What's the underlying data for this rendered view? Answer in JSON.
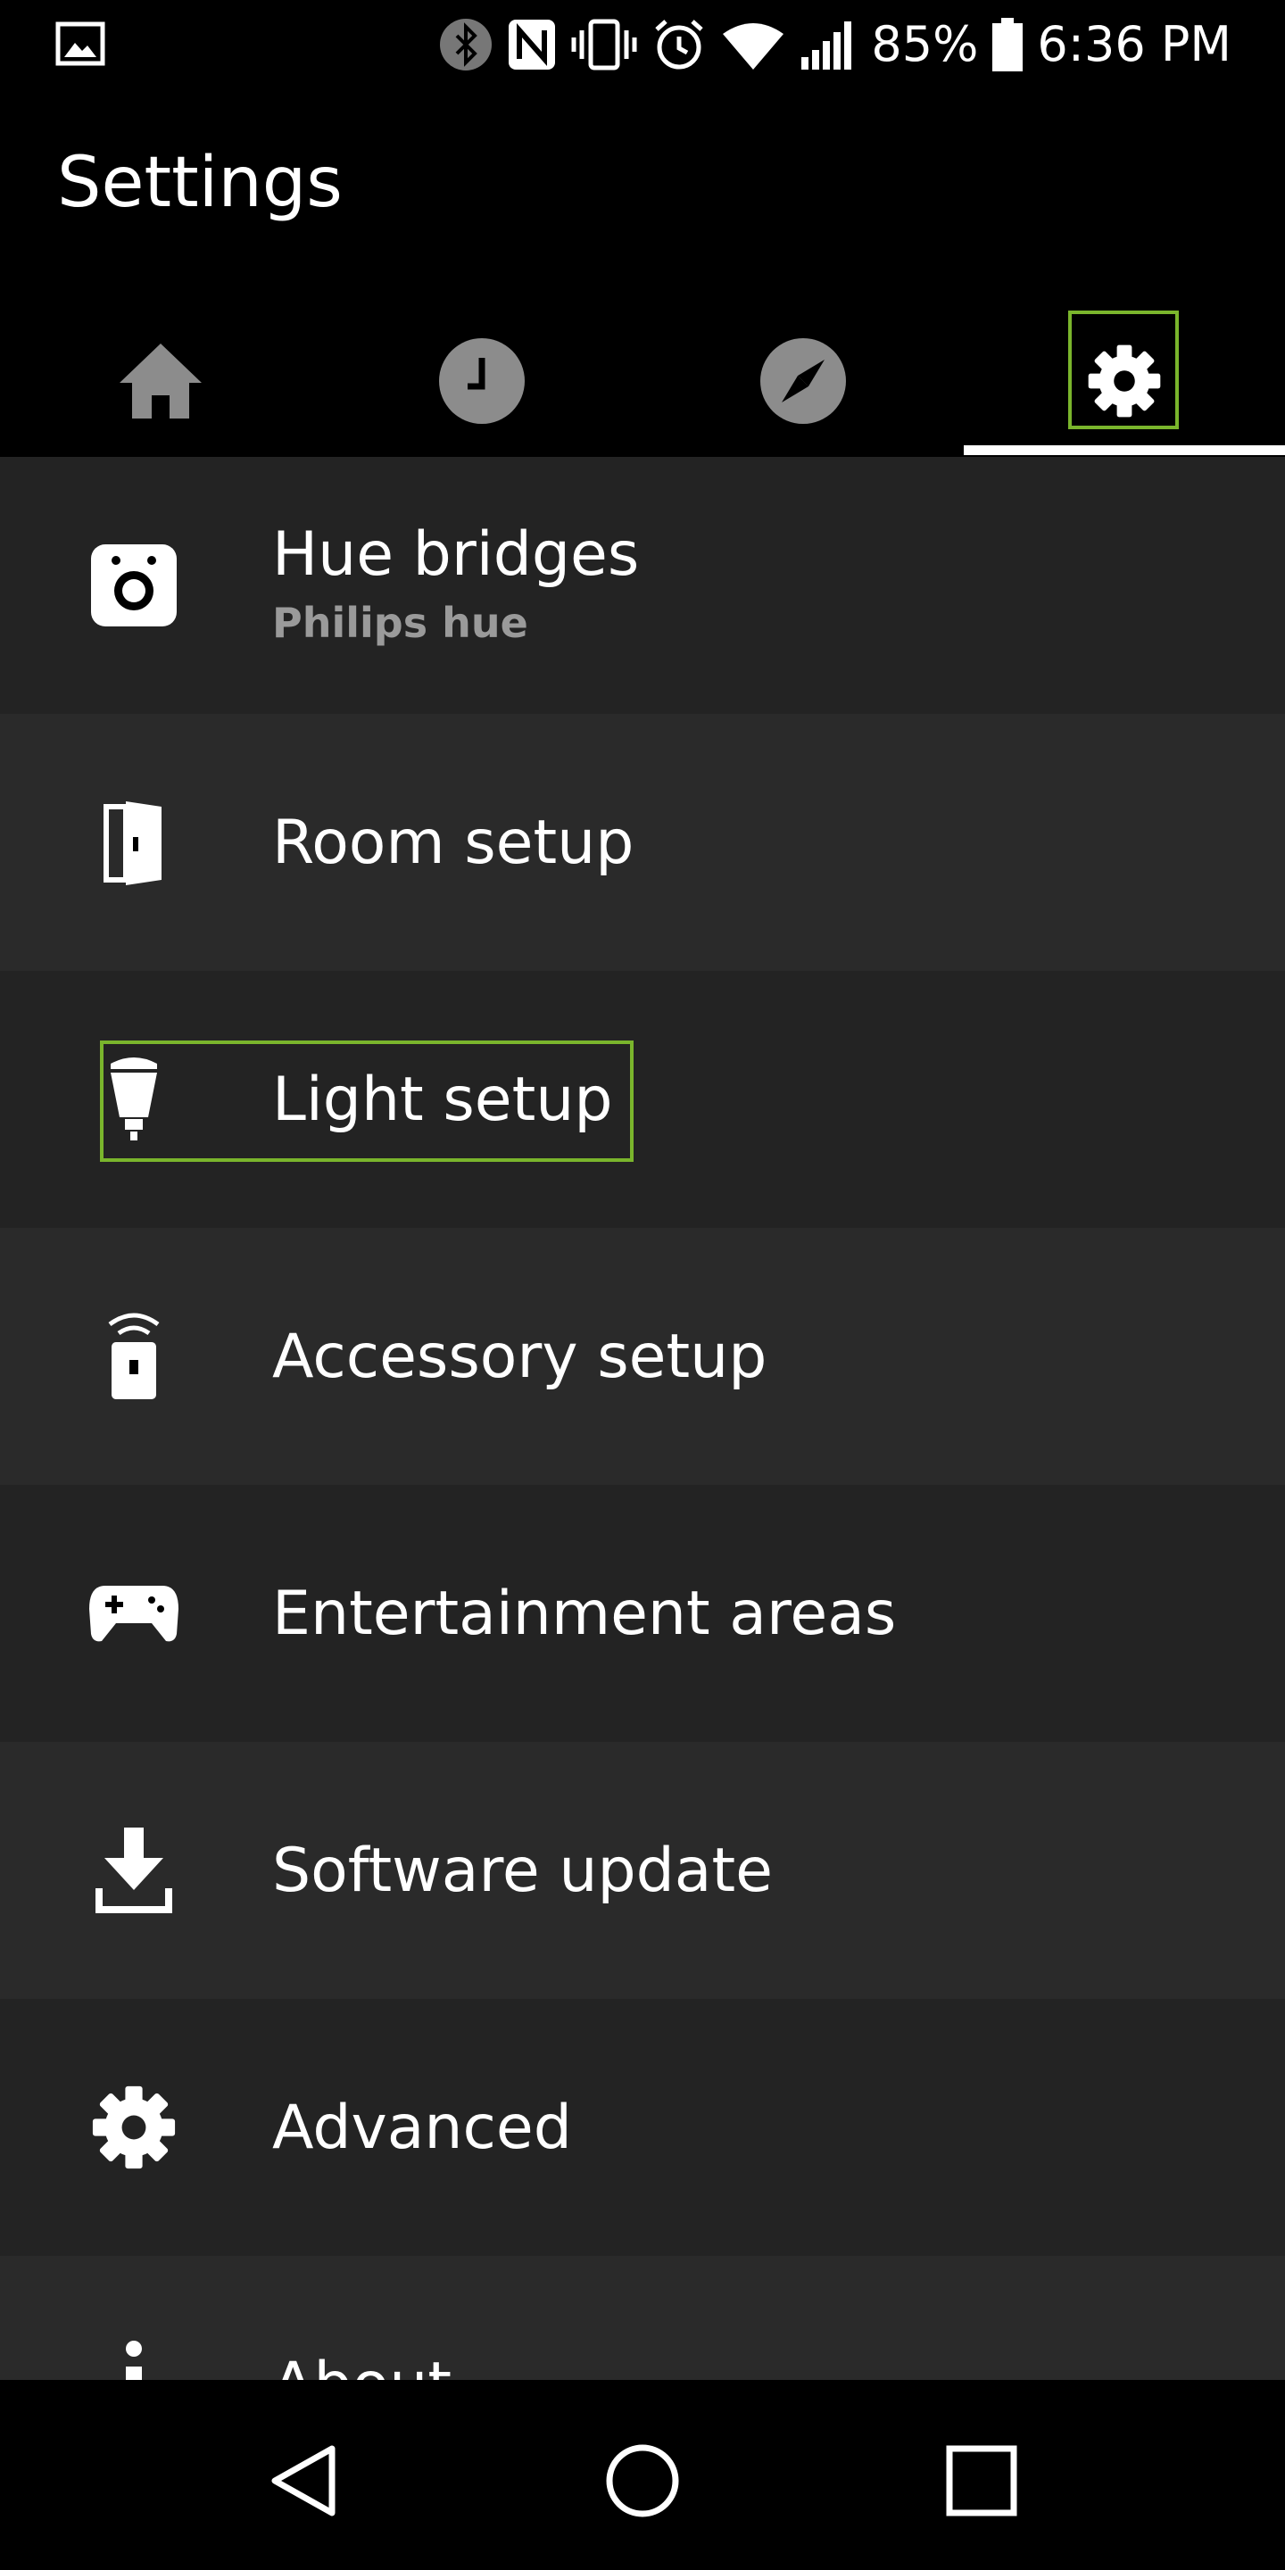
{
  "status_bar": {
    "battery_percent": "85%",
    "time": "6:36 PM",
    "icons": [
      "image-icon",
      "bluetooth-icon",
      "nfc-icon",
      "vibrate-icon",
      "alarm-icon",
      "wifi-icon",
      "signal-icon",
      "battery-icon"
    ]
  },
  "header": {
    "title": "Settings"
  },
  "tabs": [
    {
      "name": "home",
      "icon": "home-icon"
    },
    {
      "name": "routines",
      "icon": "clock-icon"
    },
    {
      "name": "explore",
      "icon": "compass-icon"
    },
    {
      "name": "settings",
      "icon": "gear-icon",
      "selected": true
    }
  ],
  "list": {
    "items": [
      {
        "label": "Hue bridges",
        "subtitle": "Philips hue",
        "icon": "bridge-icon"
      },
      {
        "label": "Room setup",
        "icon": "door-icon"
      },
      {
        "label": "Light setup",
        "icon": "bulb-icon"
      },
      {
        "label": "Accessory setup",
        "icon": "remote-icon"
      },
      {
        "label": "Entertainment areas",
        "icon": "gamepad-icon"
      },
      {
        "label": "Software update",
        "icon": "download-icon"
      },
      {
        "label": "Advanced",
        "icon": "gear-icon"
      },
      {
        "label": "About",
        "icon": "info-icon"
      }
    ]
  },
  "nav_bar": {
    "buttons": [
      "back-icon",
      "home-circle-icon",
      "recents-icon"
    ]
  },
  "colors": {
    "accent_focus": "#7ab52c",
    "tab_inactive": "#8c8c8c",
    "tab_active": "#ffffff",
    "subtitle": "#9a9a9a"
  }
}
